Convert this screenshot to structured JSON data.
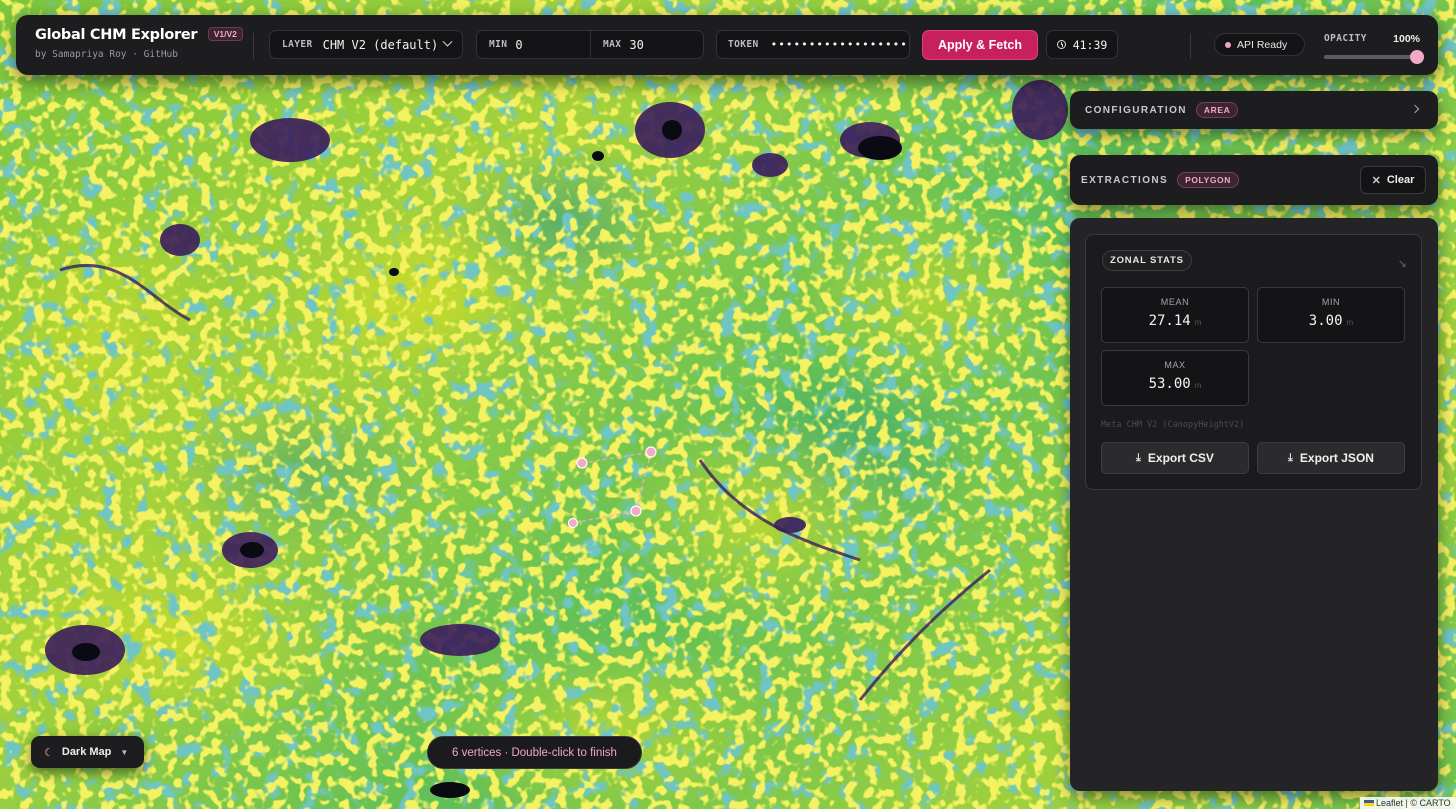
{
  "app": {
    "title": "Global CHM Explorer",
    "version_badge": "V1/V2",
    "subtitle": "by Samapriya Roy · GitHub"
  },
  "toolbar": {
    "layer_label": "LAYER",
    "layer_value": "CHM V2 (default)",
    "min_label": "MIN",
    "min_value": "0",
    "max_label": "MAX",
    "max_value": "30",
    "token_label": "TOKEN",
    "token_value": "••••••••••••••••••",
    "apply_label": "Apply & Fetch",
    "time_value": "41:39",
    "api_status": "API Ready",
    "opacity_label": "OPACITY",
    "opacity_value": "100%",
    "opacity_fraction": 1.0
  },
  "configuration": {
    "title": "CONFIGURATION",
    "tag": "AREA"
  },
  "extractions": {
    "title": "EXTRACTIONS",
    "tag": "POLYGON",
    "clear_label": "Clear"
  },
  "zonal_stats": {
    "title": "ZONAL STATS",
    "mean_label": "MEAN",
    "mean_value": "27.14",
    "mean_unit": "m",
    "min_label": "MIN",
    "min_value": "3.00",
    "min_unit": "m",
    "max_label": "MAX",
    "max_value": "53.00",
    "max_unit": "m",
    "source": "Meta CHM V2 (CanopyHeightV2)",
    "export_csv_label": "Export CSV",
    "export_json_label": "Export JSON"
  },
  "map": {
    "basemap_label": "Dark Map",
    "draw_hint": "6 vertices · Double-click to finish",
    "attribution": "Leaflet | © CARTO",
    "colors": {
      "high": "#e9e41e",
      "mid": "#2a9d8a",
      "low": "#3b1a5a",
      "accent": "#c81f5f",
      "vertex": "#f2a9c3"
    }
  }
}
